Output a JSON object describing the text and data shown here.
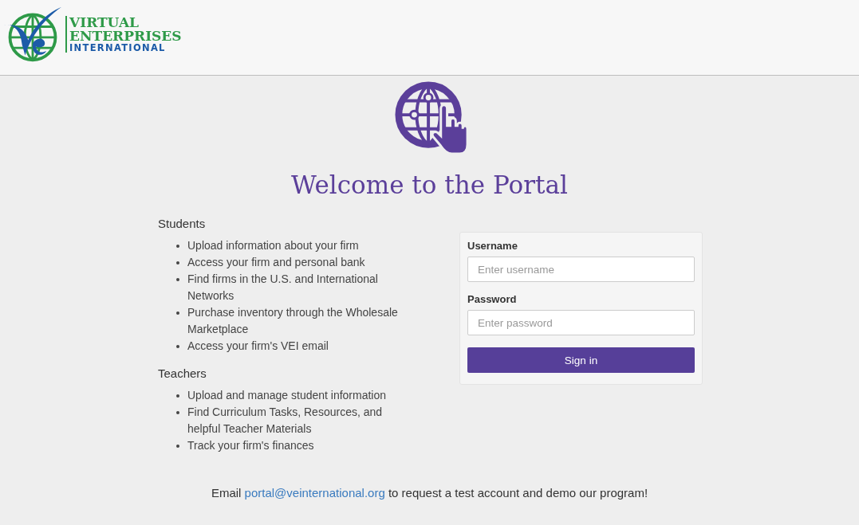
{
  "header": {
    "logo_lines": [
      "VIRTUAL",
      "ENTERPRISES",
      "INTERNATIONAL"
    ]
  },
  "title": "Welcome to the Portal",
  "sections": [
    {
      "heading": "Students",
      "items": [
        "Upload information about your firm",
        "Access your firm and personal bank",
        "Find firms in the U.S. and International Networks",
        "Purchase inventory through the Wholesale Marketplace",
        "Access your firm's VEI email"
      ]
    },
    {
      "heading": "Teachers",
      "items": [
        "Upload and manage student information",
        "Find Curriculum Tasks, Resources, and helpful Teacher Materials",
        "Track your firm's finances"
      ]
    }
  ],
  "login": {
    "fields": [
      {
        "label": "Username",
        "placeholder": "Enter username"
      },
      {
        "label": "Password",
        "placeholder": "Enter password"
      }
    ],
    "button": "Sign in"
  },
  "footer": {
    "before": "Email",
    "link": "portal@veinternational.org",
    "after": "to request a test account and demo our program!"
  }
}
